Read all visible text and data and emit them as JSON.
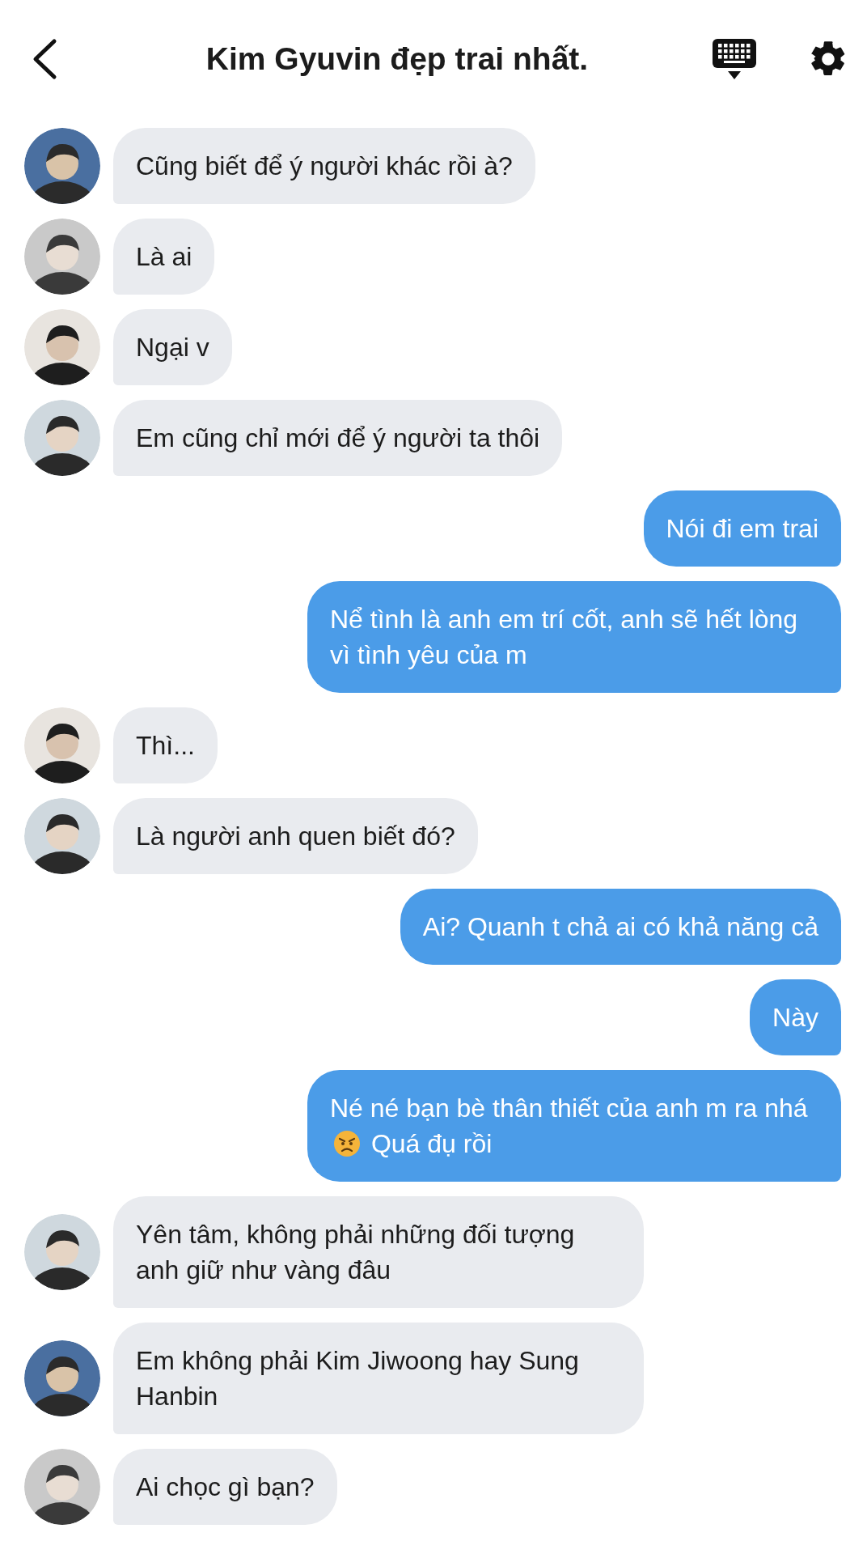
{
  "header": {
    "title": "Kim Gyuvin đẹp trai nhất."
  },
  "messages": [
    {
      "kind": "in",
      "text": "Cũng biết để ý người khác rồi à?"
    },
    {
      "kind": "in",
      "text": "Là ai"
    },
    {
      "kind": "in",
      "text": "Ngại v"
    },
    {
      "kind": "in",
      "text": "Em cũng chỉ mới để ý người ta thôi"
    },
    {
      "kind": "out",
      "text": "Nói đi em trai"
    },
    {
      "kind": "out",
      "text": "Nể tình là anh em trí cốt, anh sẽ hết lòng vì tình yêu của m"
    },
    {
      "kind": "in",
      "text": "Thì..."
    },
    {
      "kind": "in",
      "text": "Là người anh quen biết đó?"
    },
    {
      "kind": "out",
      "text": "Ai? Quanh t chả ai có khả năng cả"
    },
    {
      "kind": "out",
      "text": "Này"
    },
    {
      "kind": "out",
      "text": "Né né bạn bè thân thiết của anh m ra nhá",
      "tail": "Quá đụ rồi"
    },
    {
      "kind": "in",
      "text": "Yên tâm, không phải những đối tượng anh giữ như vàng đâu"
    },
    {
      "kind": "in",
      "text": "Em không phải Kim Jiwoong hay Sung Hanbin"
    },
    {
      "kind": "in",
      "text": "Ai chọc gì bạn?"
    }
  ]
}
